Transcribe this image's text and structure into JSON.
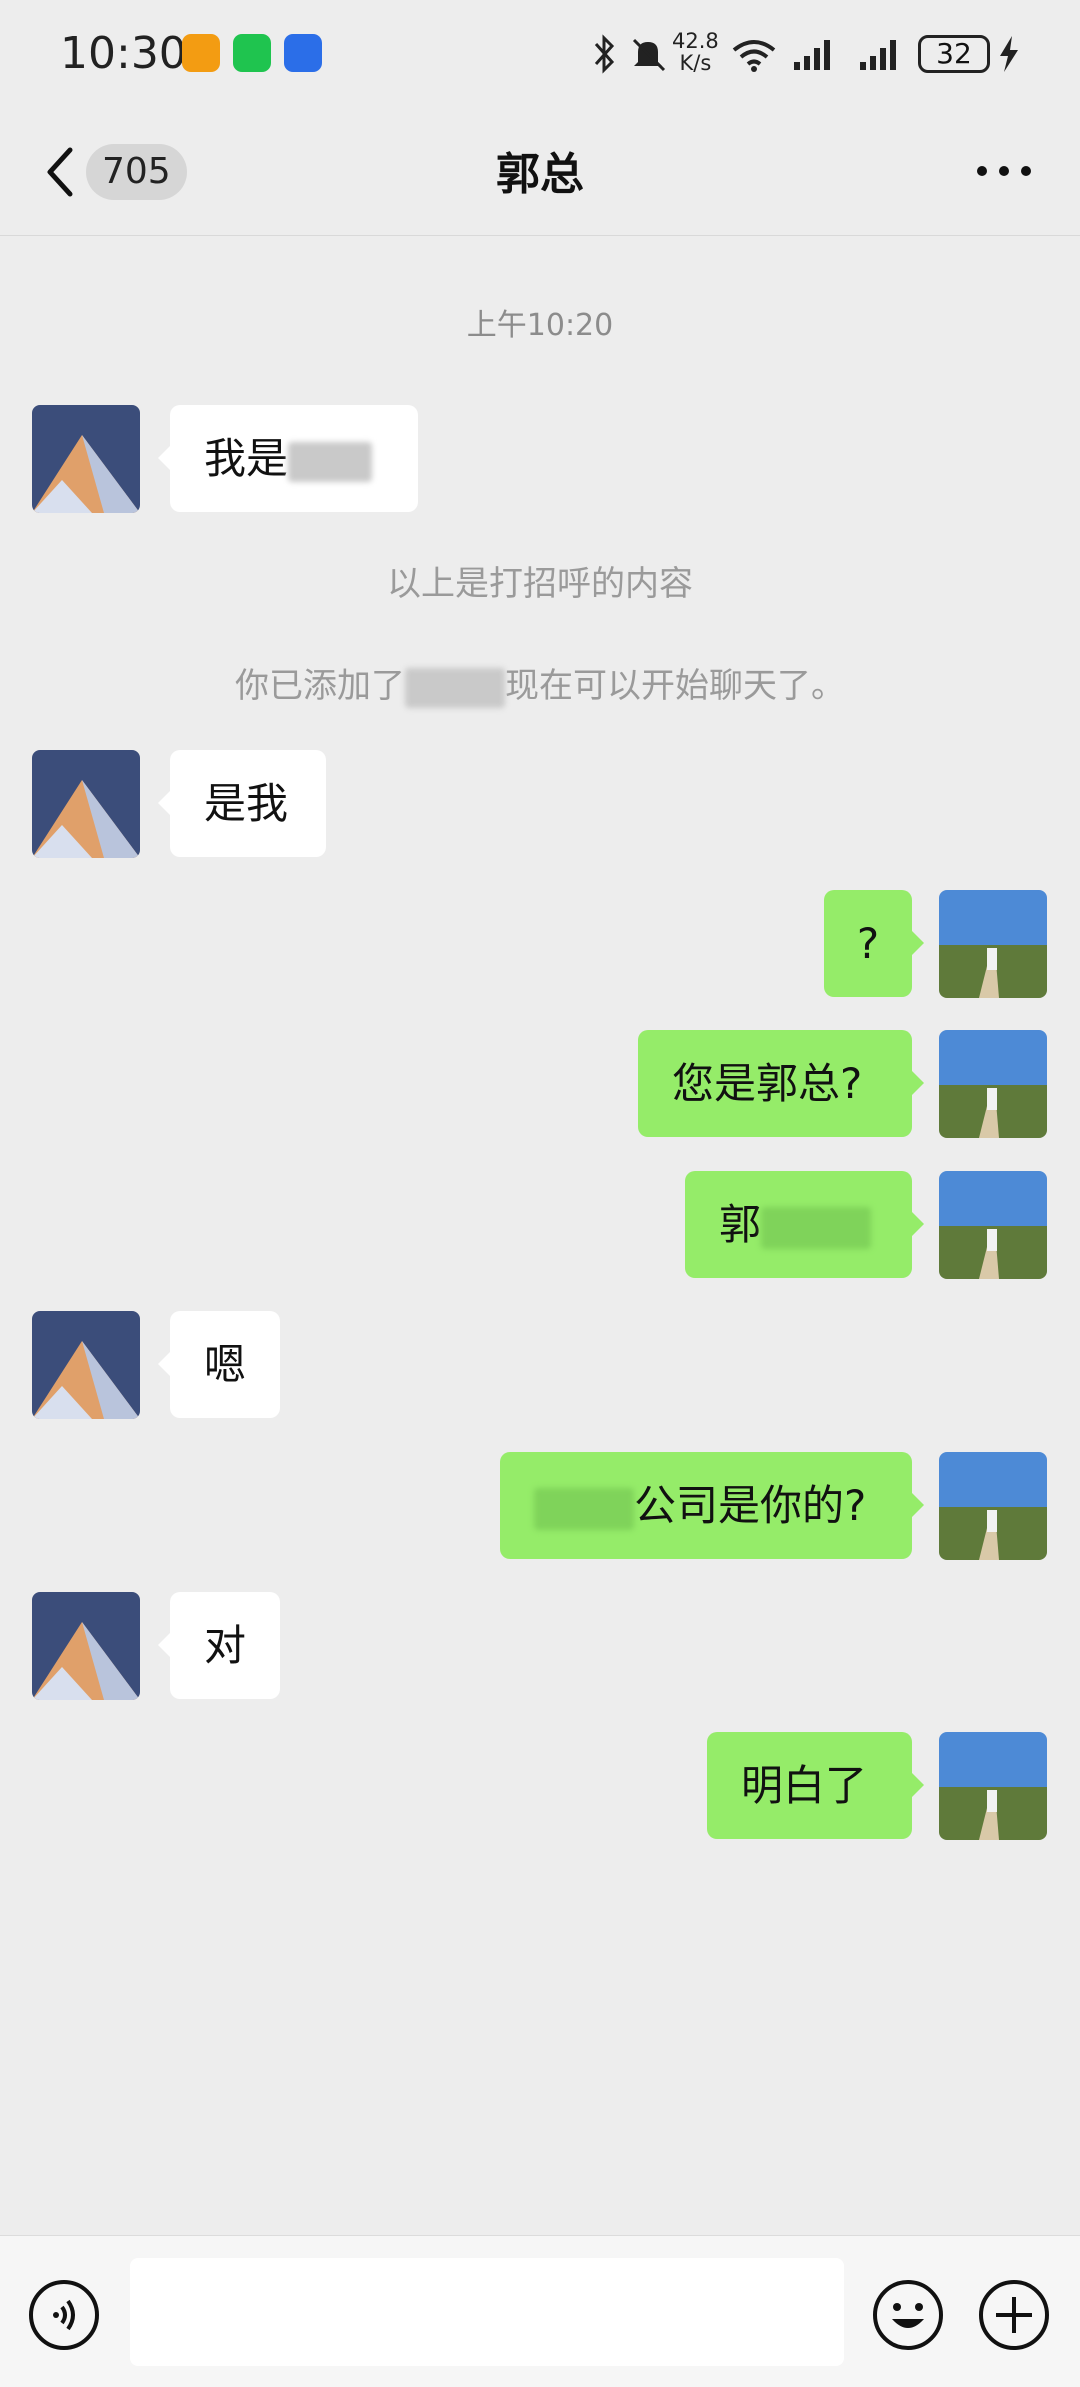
{
  "status_bar": {
    "time": "10:30",
    "net_speed_value": "42.8",
    "net_speed_unit": "K/s",
    "battery": "32",
    "icons": [
      "orange-app-icon",
      "wechat-icon",
      "blue-app-icon",
      "bluetooth-icon",
      "mute-icon",
      "wifi-icon",
      "signal-icon",
      "signal-icon",
      "battery-icon",
      "charging-icon"
    ]
  },
  "header": {
    "unread_count": "705",
    "title": "郭总"
  },
  "chat": {
    "timestamp": "上午10:20",
    "greeting_note": "以上是打招呼的内容",
    "added_note_before": "你已添加了",
    "added_note_after": "现在可以开始聊天了。",
    "messages": [
      {
        "side": "left",
        "text": "我是"
      },
      {
        "side": "left",
        "text": "是我"
      },
      {
        "side": "right",
        "text": "?"
      },
      {
        "side": "right",
        "text": "您是郭总?"
      },
      {
        "side": "right",
        "text": "郭"
      },
      {
        "side": "left",
        "text": "嗯"
      },
      {
        "side": "right",
        "text": "公司是你的?"
      },
      {
        "side": "left",
        "text": "对"
      },
      {
        "side": "right",
        "text": "明白了"
      }
    ]
  },
  "input_bar": {
    "placeholder": ""
  },
  "colors": {
    "background": "#ededed",
    "bubble_self": "#95ec69",
    "bubble_other": "#ffffff"
  }
}
